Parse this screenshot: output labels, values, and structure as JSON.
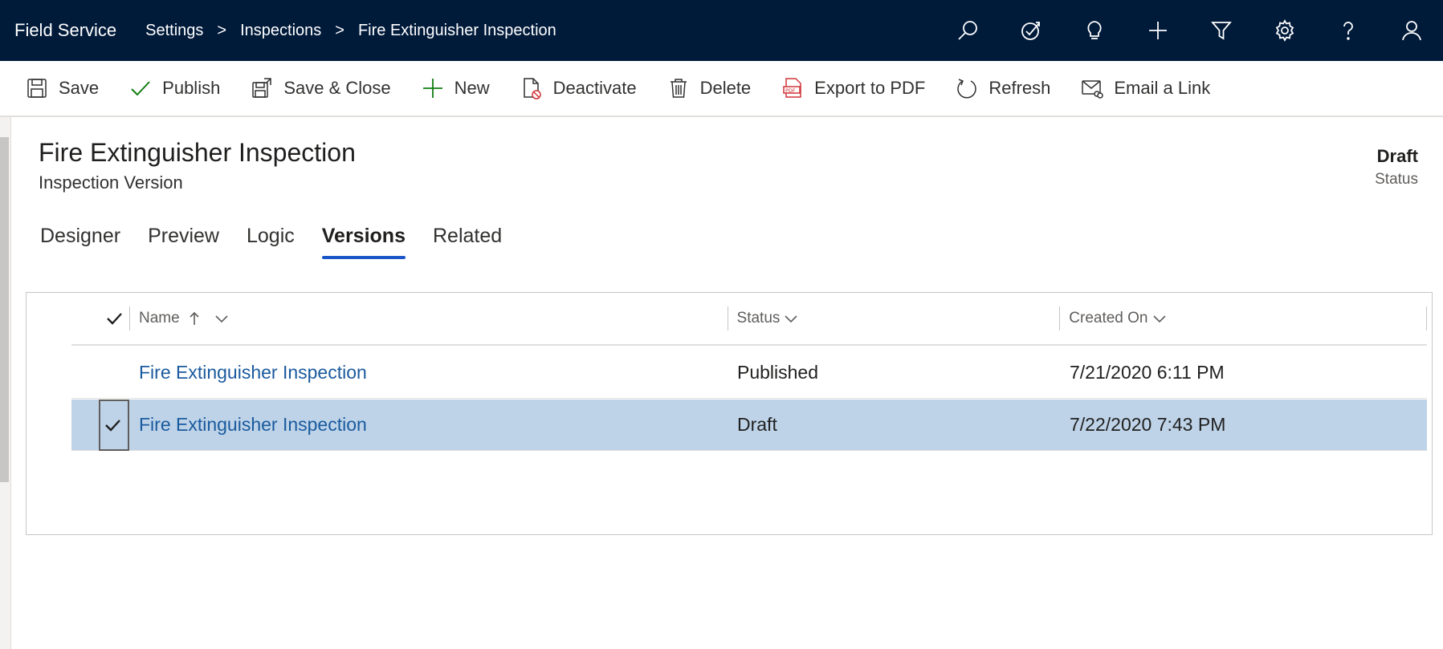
{
  "app": {
    "name": "Field Service"
  },
  "breadcrumb": [
    {
      "label": "Settings"
    },
    {
      "label": "Inspections"
    },
    {
      "label": "Fire Extinguisher Inspection"
    }
  ],
  "breadcrumb_separator": ">",
  "top_icons": [
    "search-icon",
    "target-check-icon",
    "lightbulb-icon",
    "plus-icon",
    "filter-icon",
    "gear-icon",
    "help-icon",
    "user-icon"
  ],
  "commands": {
    "save": "Save",
    "publish": "Publish",
    "save_close": "Save & Close",
    "new": "New",
    "deactivate": "Deactivate",
    "delete": "Delete",
    "export_pdf": "Export to PDF",
    "refresh": "Refresh",
    "email_link": "Email a Link"
  },
  "record": {
    "title": "Fire Extinguisher Inspection",
    "subtitle": "Inspection Version",
    "status_value": "Draft",
    "status_label": "Status"
  },
  "tabs": [
    {
      "label": "Designer",
      "active": false
    },
    {
      "label": "Preview",
      "active": false
    },
    {
      "label": "Logic",
      "active": false
    },
    {
      "label": "Versions",
      "active": true
    },
    {
      "label": "Related",
      "active": false
    }
  ],
  "grid": {
    "columns": {
      "name": "Name",
      "status": "Status",
      "created_on": "Created On"
    },
    "rows": [
      {
        "name": "Fire Extinguisher Inspection",
        "status": "Published",
        "created_on": "7/21/2020 6:11 PM",
        "selected": false
      },
      {
        "name": "Fire Extinguisher Inspection",
        "status": "Draft",
        "created_on": "7/22/2020 7:43 PM",
        "selected": true
      }
    ]
  },
  "colors": {
    "nav_bg": "#001a3a",
    "accent": "#1a56c8",
    "selected_row": "#bed3e8",
    "link": "#1a5a9e",
    "publish_icon": "#107c10",
    "new_icon": "#107c10",
    "deactivate_badge": "#d13438",
    "pdf_icon": "#d13438"
  }
}
